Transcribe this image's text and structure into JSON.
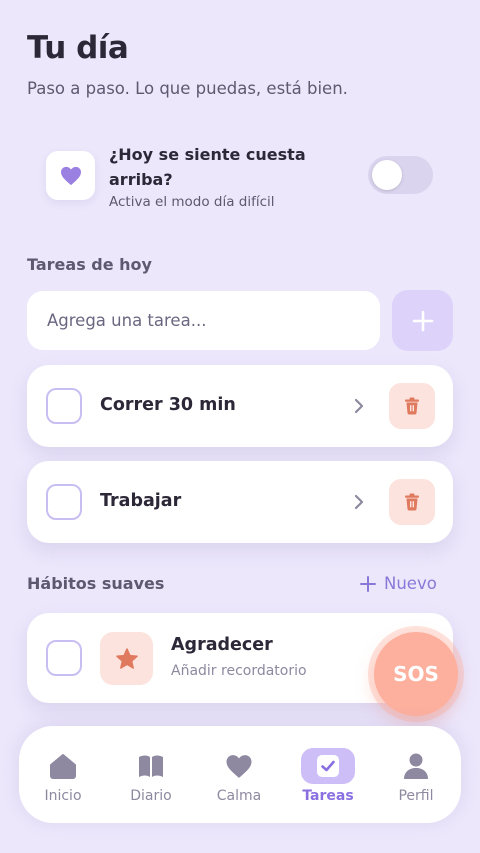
{
  "header": {
    "title": "Tu día",
    "subtitle": "Paso a paso. Lo que puedas, está bien."
  },
  "hard_day": {
    "question": "¿Hoy se siente cuesta arriba?",
    "description": "Activa el modo día difícil",
    "toggle_on": false,
    "icon": "heart-icon"
  },
  "tasks": {
    "section_title": "Tareas de hoy",
    "input_placeholder": "Agrega una tarea...",
    "add_icon": "plus-icon",
    "items": [
      {
        "name": "Correr 30 min",
        "done": false
      },
      {
        "name": "Trabajar",
        "done": false
      }
    ]
  },
  "habits": {
    "section_title": "Hábitos suaves",
    "new_label": "Nuevo",
    "items": [
      {
        "name": "Agradecer",
        "reminder": "Añadir recordatorio",
        "icon": "star-icon",
        "done": false
      }
    ]
  },
  "sos": {
    "label": "SOS"
  },
  "nav": {
    "items": [
      {
        "label": "Inicio",
        "icon": "home-icon",
        "active": false
      },
      {
        "label": "Diario",
        "icon": "book-icon",
        "active": false
      },
      {
        "label": "Calma",
        "icon": "heart-icon",
        "active": false
      },
      {
        "label": "Tareas",
        "icon": "check-square-icon",
        "active": true
      },
      {
        "label": "Perfil",
        "icon": "user-icon",
        "active": false
      }
    ]
  },
  "colors": {
    "background": "#ECE7FB",
    "accent": "#8A6FE0",
    "accent_soft": "#CDBEF7",
    "danger_soft": "#FCE3DD",
    "danger": "#E07A5F",
    "sos": "#FDB09E"
  }
}
